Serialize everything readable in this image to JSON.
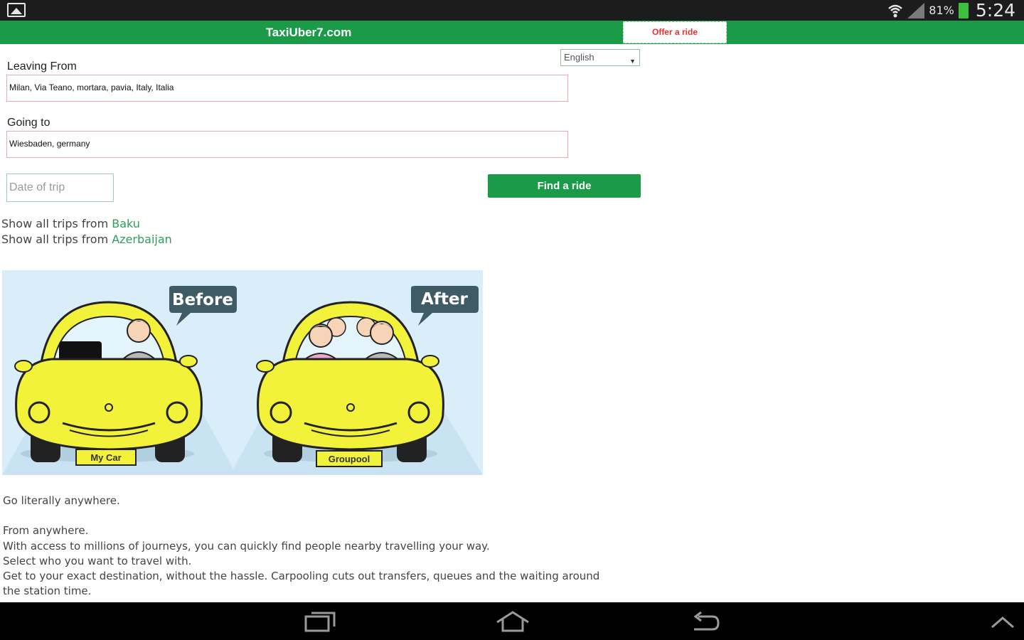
{
  "status_bar": {
    "battery": "81%",
    "time": "5:24"
  },
  "header": {
    "title": "TaxiUber7.com",
    "offer_tab": "Offer a ride"
  },
  "language": {
    "selected": "English"
  },
  "form": {
    "leaving_label": "Leaving From",
    "leaving_value": "Milan, Via Teano, mortara, pavia, Italy, Italia",
    "going_label": "Going to",
    "going_value": "Wiesbaden, germany",
    "date_placeholder": "Date of trip",
    "find_button": "Find a ride"
  },
  "trips": {
    "prefix": "Show all trips from ",
    "city_link": "Baku",
    "country_link": "Azerbaijan"
  },
  "promo": {
    "before": "Before",
    "after": "After",
    "plate_left": "My Car",
    "plate_right": "Groupool"
  },
  "description": {
    "line1": "Go literally anywhere.",
    "line2": "From anywhere.",
    "line3": "With access to millions of journeys, you can quickly find people nearby travelling your way.",
    "line4": "Select who you want to travel with.",
    "line5": "Get to your exact destination, without the hassle. Carpooling cuts out transfers, queues and the waiting around",
    "line6": "the station time."
  },
  "colors": {
    "brand_green": "#1b9b48",
    "offer_red": "#e8302a",
    "car_yellow": "#f2f23a"
  }
}
